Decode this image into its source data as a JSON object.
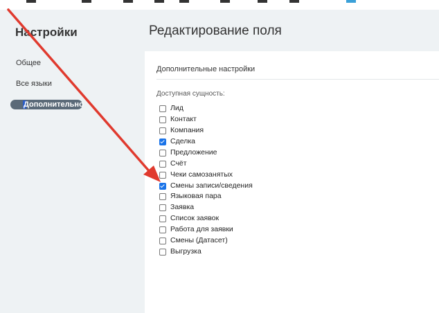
{
  "sidebar": {
    "title": "Настройки",
    "items": [
      {
        "label": "Общее",
        "active": false
      },
      {
        "label": "Все языки",
        "active": false
      },
      {
        "label": "Дополнительно",
        "active": true
      }
    ]
  },
  "page": {
    "title": "Редактирование поля"
  },
  "section": {
    "title": "Дополнительные настройки"
  },
  "field": {
    "label": "Доступная сущность:",
    "options": [
      {
        "label": "Лид",
        "checked": false
      },
      {
        "label": "Контакт",
        "checked": false
      },
      {
        "label": "Компания",
        "checked": false
      },
      {
        "label": "Сделка",
        "checked": true
      },
      {
        "label": "Предложение",
        "checked": false
      },
      {
        "label": "Счёт",
        "checked": false
      },
      {
        "label": "Чеки самозанятых",
        "checked": false
      },
      {
        "label": "Смены записи/сведения",
        "checked": true
      },
      {
        "label": "Языковая пара",
        "checked": false
      },
      {
        "label": "Заявка",
        "checked": false
      },
      {
        "label": "Список заявок",
        "checked": false
      },
      {
        "label": "Работа для заявки",
        "checked": false
      },
      {
        "label": "Смены (Датасет)",
        "checked": false
      },
      {
        "label": "Выгрузка",
        "checked": false
      }
    ]
  },
  "colors": {
    "accent": "#1a73e8",
    "arrow": "#e03a2e",
    "nav_active_bg": "#5b6a78"
  },
  "annotation": {
    "arrow_icon": "red-arrow-icon"
  }
}
